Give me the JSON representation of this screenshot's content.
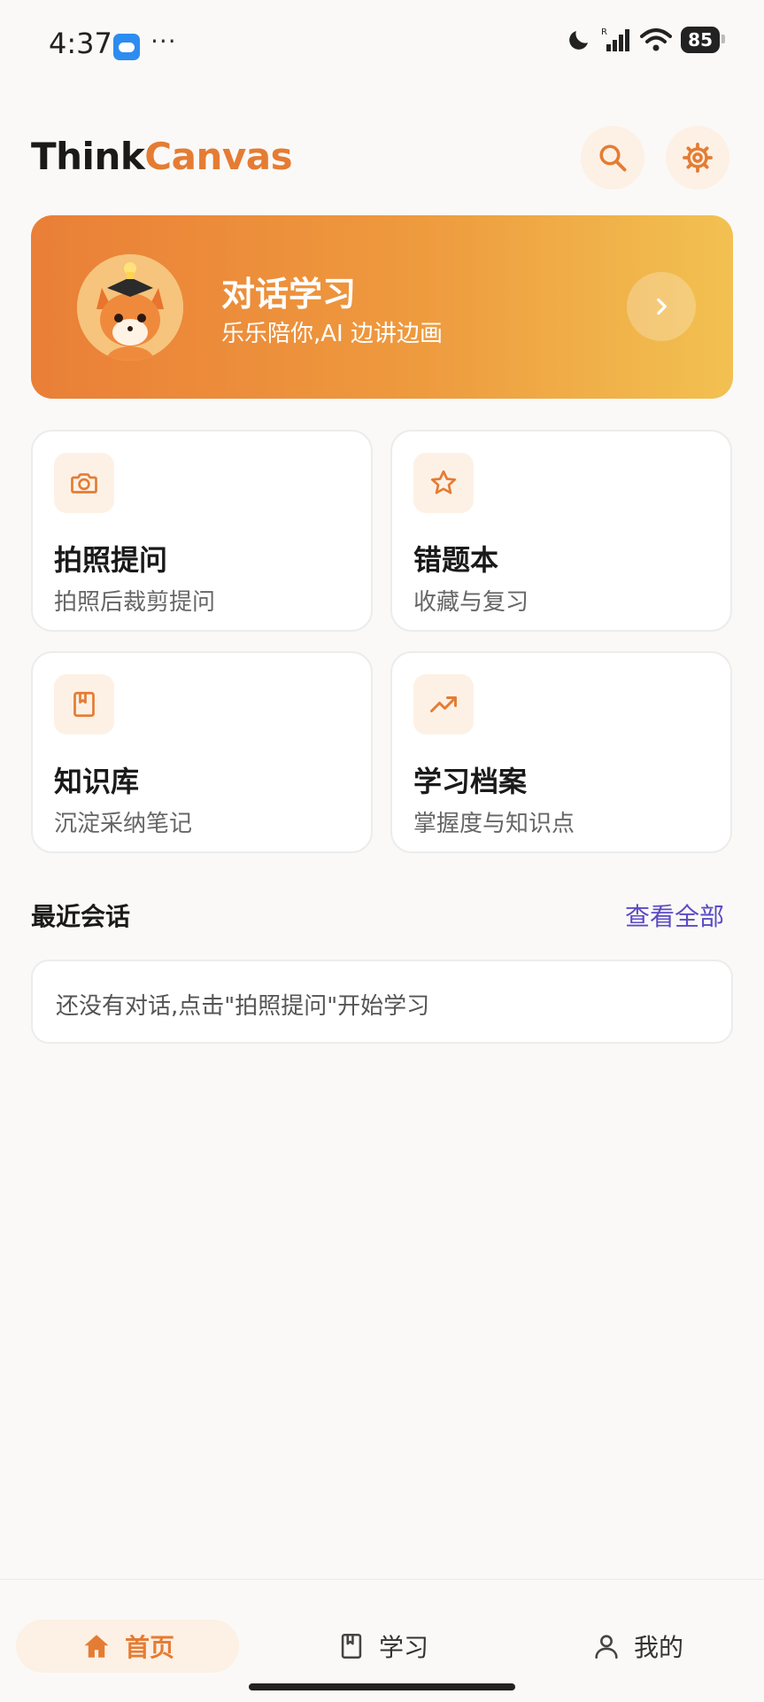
{
  "status_bar": {
    "time": "4:37",
    "dots": "···",
    "battery": "85"
  },
  "header": {
    "brand_part1": "Think",
    "brand_part2": "Canvas"
  },
  "hero": {
    "title": "对话学习",
    "subtitle": "乐乐陪你,AI 边讲边画"
  },
  "features": [
    {
      "title": "拍照提问",
      "subtitle": "拍照后裁剪提问",
      "icon": "camera-icon"
    },
    {
      "title": "错题本",
      "subtitle": "收藏与复习",
      "icon": "star-icon"
    },
    {
      "title": "知识库",
      "subtitle": "沉淀采纳笔记",
      "icon": "book-icon"
    },
    {
      "title": "学习档案",
      "subtitle": "掌握度与知识点",
      "icon": "trending-up-icon"
    }
  ],
  "recent": {
    "title": "最近会话",
    "view_all": "查看全部",
    "empty_text": "还没有对话,点击\"拍照提问\"开始学习"
  },
  "nav": {
    "home": "首页",
    "learn": "学习",
    "mine": "我的"
  },
  "colors": {
    "accent": "#e57c33",
    "link": "#5b4bc4",
    "background": "#faf9f7"
  }
}
